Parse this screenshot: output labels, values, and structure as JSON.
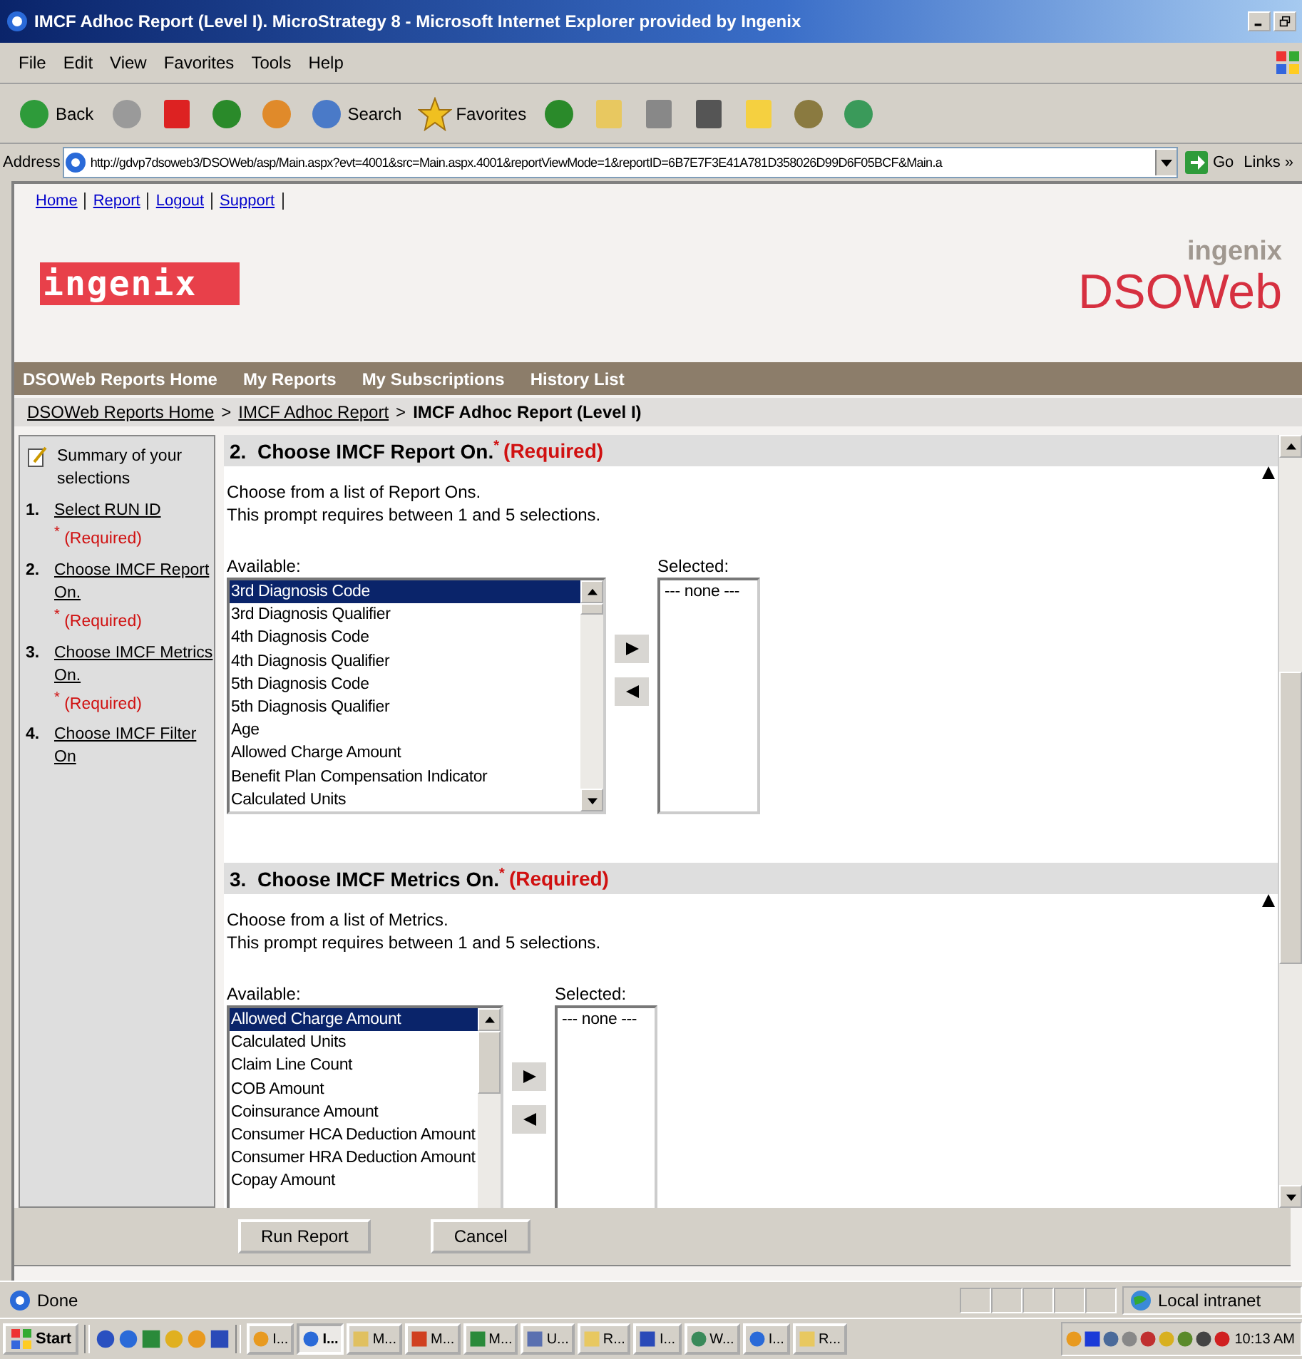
{
  "window": {
    "title": "IMCF Adhoc Report (Level I). MicroStrategy 8 - Microsoft Internet Explorer provided by Ingenix"
  },
  "menu": [
    "File",
    "Edit",
    "View",
    "Favorites",
    "Tools",
    "Help"
  ],
  "toolbar": [
    {
      "kind": "back",
      "label": "Back"
    },
    {
      "kind": "forward"
    },
    {
      "kind": "stop"
    },
    {
      "kind": "refresh"
    },
    {
      "kind": "home"
    },
    {
      "kind": "search",
      "label": "Search"
    },
    {
      "kind": "favorites",
      "label": "Favorites"
    },
    {
      "kind": "media"
    },
    {
      "kind": "mail"
    },
    {
      "kind": "print"
    },
    {
      "kind": "edit"
    },
    {
      "kind": "note"
    },
    {
      "kind": "research"
    },
    {
      "kind": "messenger"
    }
  ],
  "address": {
    "label": "Address",
    "value": "http://gdvp7dsoweb3/DSOWeb/asp/Main.aspx?evt=4001&src=Main.aspx.4001&reportViewMode=1&reportID=6B7E7F3E41A781D358026D99D6F05BCF&Main.a",
    "go": "Go",
    "links": "Links",
    "links_more": "»"
  },
  "page": {
    "top_links": [
      "Home",
      "Report",
      "Logout",
      "Support"
    ],
    "logo": "ingenix",
    "brand_small": "ingenix",
    "brand": "DSOWeb",
    "nav": [
      "DSOWeb Reports Home",
      "My Reports",
      "My Subscriptions",
      "History List"
    ],
    "breadcrumb": [
      {
        "label": "DSOWeb Reports Home",
        "current": false
      },
      {
        "separator": ">",
        "label": "IMCF Adhoc Report",
        "current": false
      },
      {
        "separator": ">",
        "label": "IMCF Adhoc Report (Level I)",
        "current": true
      }
    ],
    "summary": {
      "title": "Summary of your selections",
      "items": [
        {
          "number": "1.",
          "label": "Select RUN ID",
          "mark": "*",
          "note": "(Required)"
        },
        {
          "number": "2.",
          "label": "Choose IMCF Report On.",
          "mark": "*",
          "note": "(Required)"
        },
        {
          "number": "3.",
          "label": "Choose IMCF Metrics On.",
          "mark": "*",
          "note": "(Required)"
        },
        {
          "number": "4.",
          "label": "Choose IMCF Filter On"
        }
      ]
    },
    "prompts": [
      {
        "number": "2.",
        "title": "Choose IMCF Report On.",
        "mark": "*",
        "note": "(Required)",
        "description": [
          "Choose from a list of Report Ons.",
          "This prompt requires between 1 and 5 selections."
        ],
        "available_label": "Available:",
        "available": [
          {
            "label": "3rd Diagnosis Code",
            "selected": true
          },
          {
            "label": "3rd Diagnosis Qualifier",
            "selected": false
          },
          {
            "label": "4th Diagnosis Code",
            "selected": false
          },
          {
            "label": "4th Diagnosis Qualifier",
            "selected": false
          },
          {
            "label": "5th Diagnosis Code",
            "selected": false
          },
          {
            "label": "5th Diagnosis Qualifier",
            "selected": false
          },
          {
            "label": "Age",
            "selected": false
          },
          {
            "label": "Allowed Charge Amount",
            "selected": false
          },
          {
            "label": "Benefit Plan Compensation Indicator",
            "selected": false
          },
          {
            "label": "Calculated Units",
            "selected": false
          }
        ],
        "selected_label": "Selected:",
        "selected_items": [
          "--- none ---"
        ]
      },
      {
        "number": "3.",
        "title": "Choose IMCF Metrics On.",
        "mark": "*",
        "note": "(Required)",
        "description": [
          "Choose from a list of Metrics.",
          "This prompt requires between 1 and 5 selections."
        ],
        "available_label": "Available:",
        "available": [
          {
            "label": "Allowed Charge Amount",
            "selected": true
          },
          {
            "label": "Calculated Units",
            "selected": false
          },
          {
            "label": "Claim Line Count",
            "selected": false
          },
          {
            "label": "COB Amount",
            "selected": false
          },
          {
            "label": "Coinsurance Amount",
            "selected": false
          },
          {
            "label": "Consumer HCA Deduction Amount",
            "selected": false
          },
          {
            "label": "Consumer HRA Deduction Amount",
            "selected": false
          },
          {
            "label": "Copay Amount",
            "selected": false
          }
        ],
        "selected_label": "Selected:",
        "selected_items": [
          "--- none ---"
        ]
      }
    ],
    "buttons": [
      "Run Report",
      "Cancel"
    ]
  },
  "status_bar": {
    "text": "Done",
    "zone": "Local intranet"
  },
  "taskbar": {
    "start": "Start",
    "tasks": [
      {
        "kind": "clock",
        "label": "I...",
        "selected": false
      },
      {
        "kind": "ie",
        "label": "I...",
        "selected": true
      },
      {
        "kind": "folder",
        "label": "M...",
        "selected": false
      },
      {
        "kind": "slides",
        "label": "M...",
        "selected": false
      },
      {
        "kind": "sheet",
        "label": "M...",
        "selected": false
      },
      {
        "kind": "grid",
        "label": "U...",
        "selected": false
      },
      {
        "kind": "mail",
        "label": "R...",
        "selected": false
      },
      {
        "kind": "doc",
        "label": "I...",
        "selected": false
      },
      {
        "kind": "people",
        "label": "W...",
        "selected": false
      },
      {
        "kind": "ie",
        "label": "I...",
        "selected": false
      },
      {
        "kind": "mail",
        "label": "R...",
        "selected": false
      }
    ],
    "clock": "10:13 AM"
  }
}
